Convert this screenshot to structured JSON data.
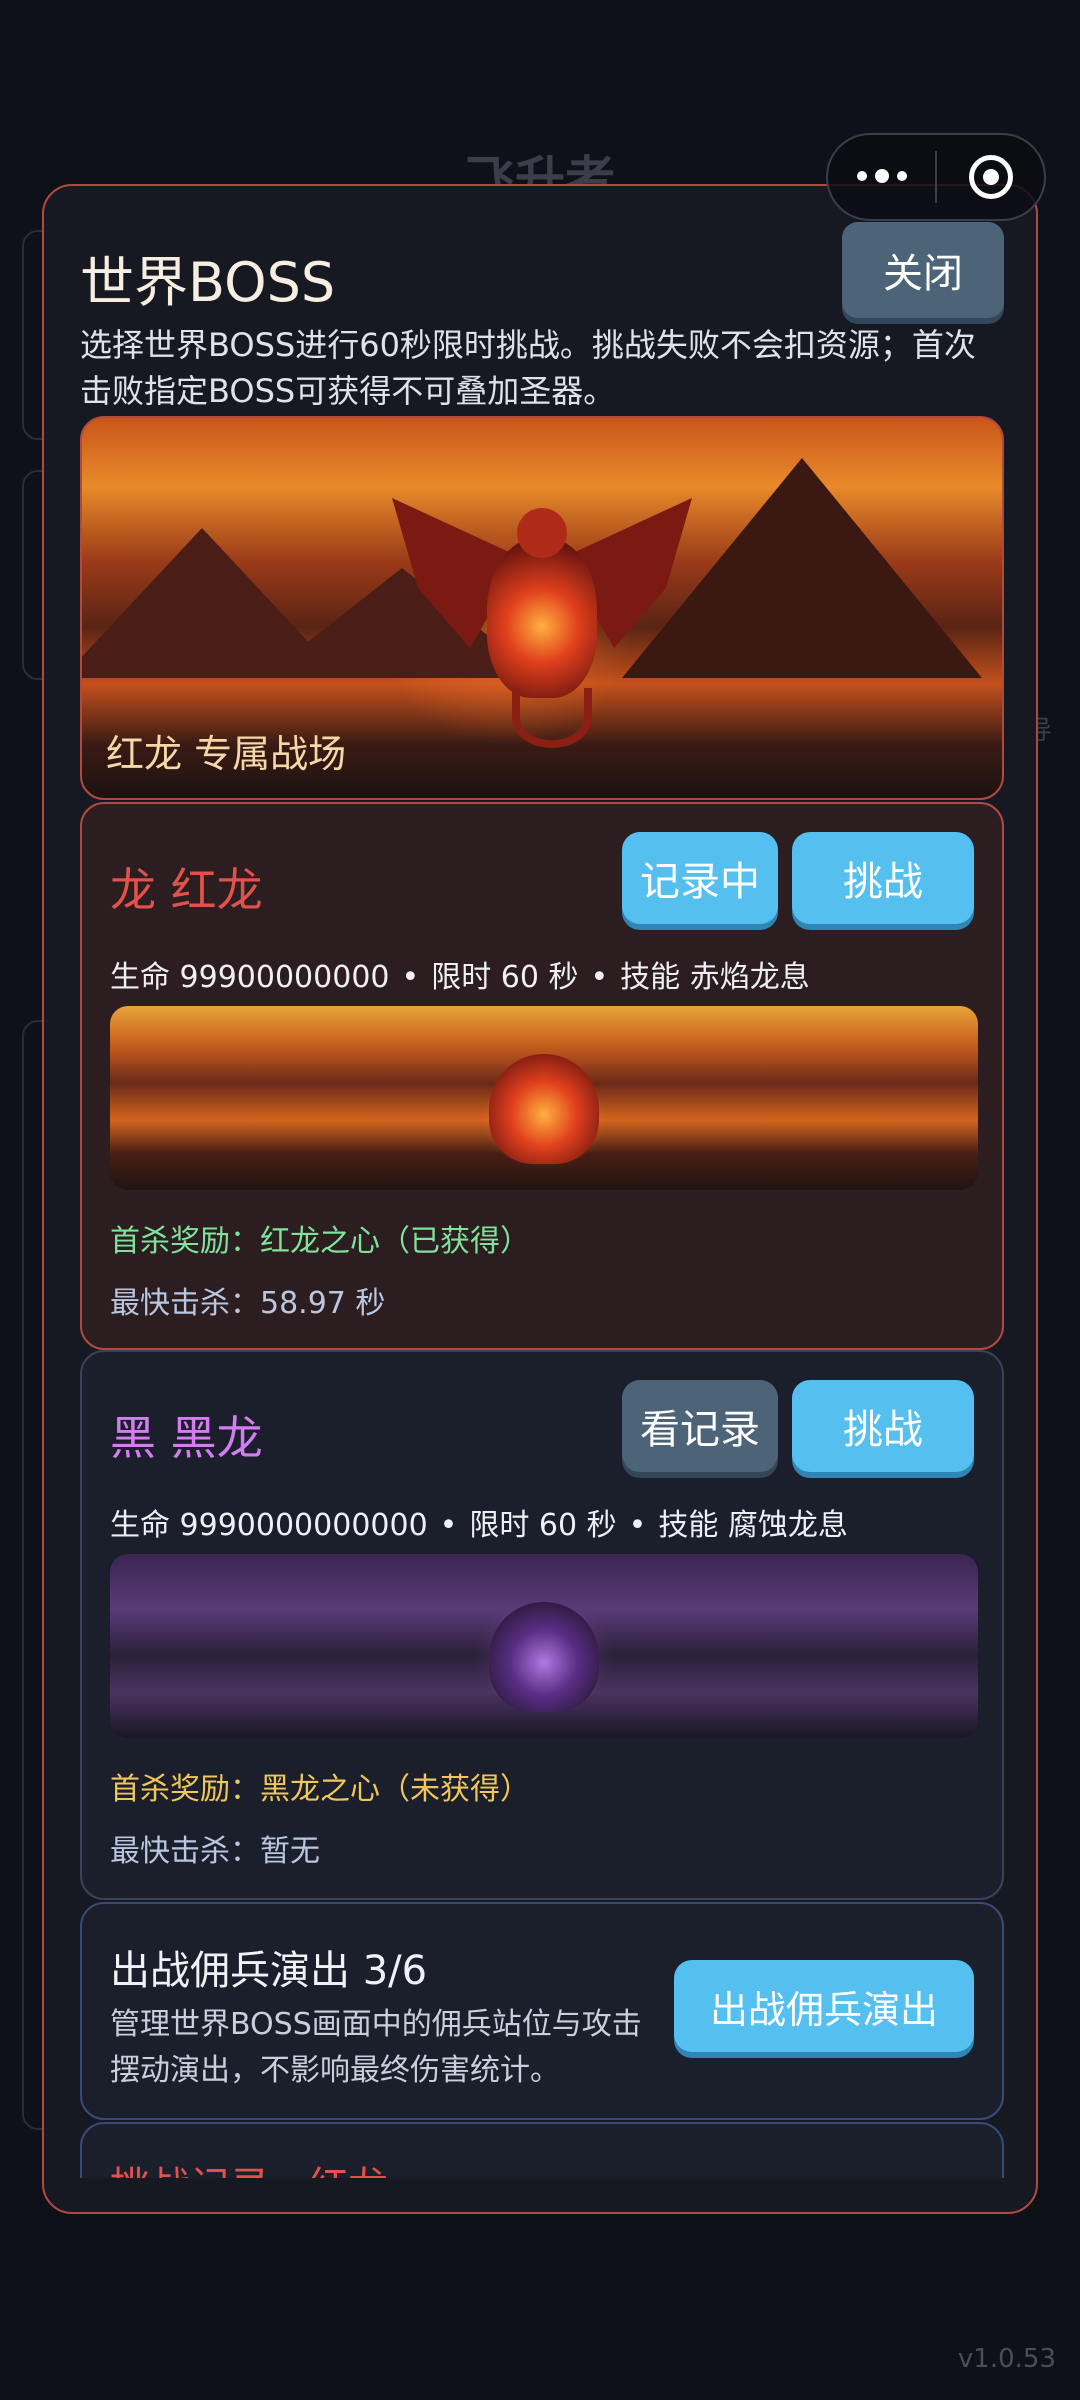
{
  "background": {
    "title": "飞升者",
    "side_text": "导"
  },
  "capsule": {
    "more_icon": "more-dots-icon",
    "close_icon": "target-circle-icon"
  },
  "modal": {
    "title": "世界BOSS",
    "close_label": "关闭",
    "description": "选择世界BOSS进行60秒限时挑战。挑战失败不会扣资源；首次击败指定BOSS可获得不可叠加圣器。",
    "hero_label": "红龙 专属战场"
  },
  "bosses": [
    {
      "name": "龙 红龙",
      "record_label": "记录中",
      "fight_label": "挑战",
      "hp": "生命 99900000000",
      "time": "限时 60 秒",
      "skill": "技能 赤焰龙息",
      "reward": "首杀奖励：红龙之心（已获得）",
      "fastest": "最快击杀：58.97 秒",
      "name_color": "#e2524a",
      "reward_color": "#7fe39b"
    },
    {
      "name": "黑 黑龙",
      "record_label": "看记录",
      "fight_label": "挑战",
      "hp": "生命 9990000000000",
      "time": "限时 60 秒",
      "skill": "技能 腐蚀龙息",
      "reward": "首杀奖励：黑龙之心（未获得）",
      "fastest": "最快击杀：暂无",
      "name_color": "#d57cf2",
      "reward_color": "#f1c65a"
    }
  ],
  "mercenary": {
    "title": "出战佣兵演出 3/6",
    "description": "管理世界BOSS画面中的佣兵站位与攻击摆动演出，不影响最终伤害统计。",
    "button_label": "出战佣兵演出"
  },
  "record": {
    "title": "挑战记录 · 红龙"
  },
  "version": "v1.0.53"
}
